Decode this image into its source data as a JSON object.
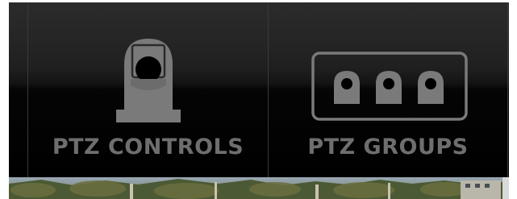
{
  "toolbar": {
    "tiles": [
      {
        "label": "PTZ CONTROLS",
        "icon": "ptz-camera-icon"
      },
      {
        "label": "PTZ GROUPS",
        "icon": "ptz-group-icon"
      }
    ]
  },
  "colors": {
    "panel_top": "#2b2b2b",
    "panel_bottom": "#000000",
    "label": "#6e6e6e",
    "icon": "#7a7a7a"
  },
  "camera_feed": {
    "icon": "camera-feed-thumbnail"
  }
}
